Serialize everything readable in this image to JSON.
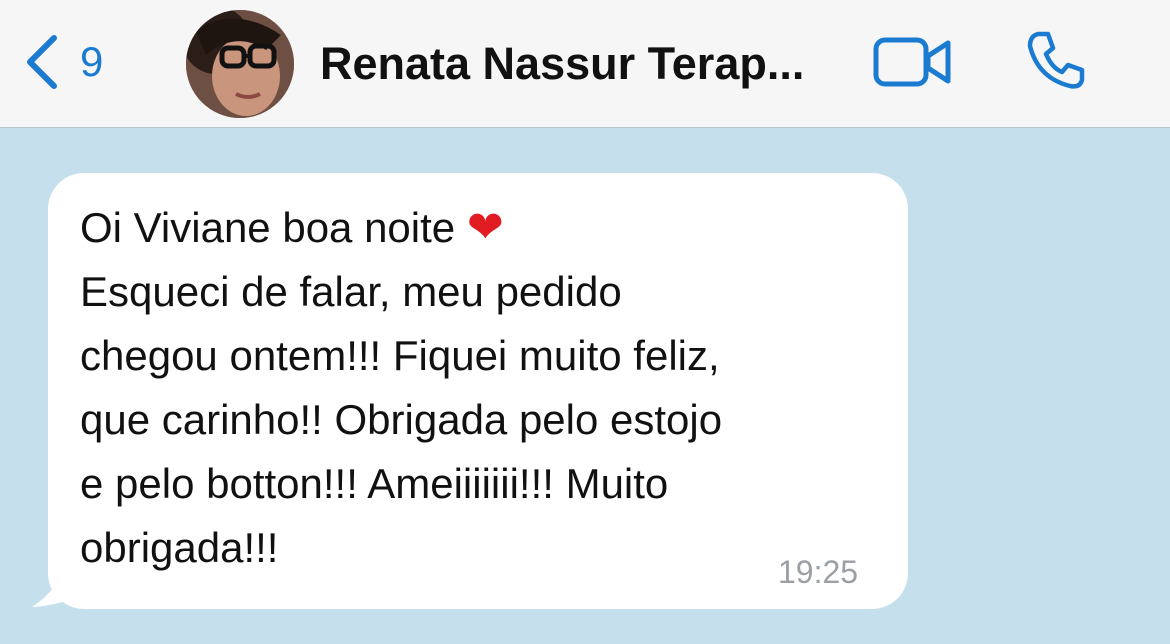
{
  "header": {
    "back_count": "9",
    "contact_name": "Renata  Nassur Terap..."
  },
  "message": {
    "line1": "Oi Viviane boa noite",
    "emoji": "❤",
    "body": "Esqueci de falar, meu pedido\nchegou ontem!!! Fiquei muito feliz,\nque carinho!! Obrigada pelo estojo\ne pelo botton!!! Ameiiiiiii!!! Muito\nobrigada!!!",
    "time": "19:25"
  },
  "colors": {
    "accent": "#1a7bd0",
    "chat_background": "#c5e0ec",
    "bubble": "#ffffff",
    "header": "#f6f6f6"
  },
  "icons": [
    "chevron-left-icon",
    "video-camera-icon",
    "phone-icon"
  ]
}
